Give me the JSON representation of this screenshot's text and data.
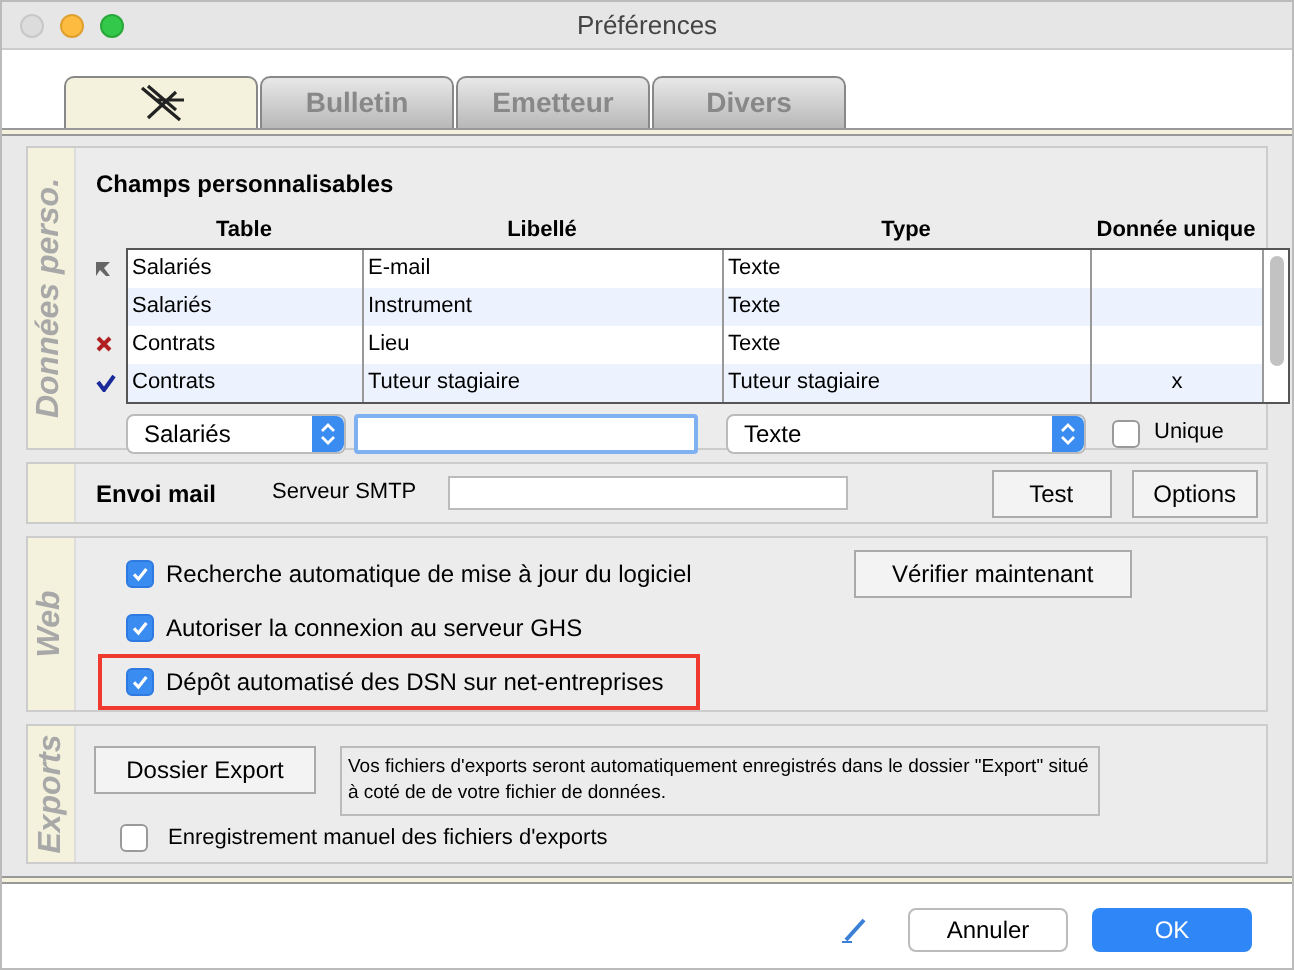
{
  "window": {
    "title": "Préférences"
  },
  "tabs": [
    {
      "kind": "icon",
      "selected": true
    },
    {
      "kind": "text",
      "label": "Bulletin",
      "selected": false
    },
    {
      "kind": "text",
      "label": "Emetteur",
      "selected": false
    },
    {
      "kind": "text",
      "label": "Divers",
      "selected": false
    }
  ],
  "custom_fields": {
    "section": "Données perso.",
    "title": "Champs personnalisables",
    "columns": [
      "Table",
      "Libellé",
      "Type",
      "Donnée unique"
    ],
    "rows": [
      {
        "kind": "pointer",
        "cells": [
          "Salariés",
          "E-mail",
          "Texte",
          ""
        ]
      },
      {
        "kind": "plain",
        "cells": [
          "Salariés",
          "Instrument",
          "Texte",
          ""
        ]
      },
      {
        "kind": "delete",
        "cells": [
          "Contrats",
          "Lieu",
          "Texte",
          ""
        ]
      },
      {
        "kind": "valid",
        "cells": [
          "Contrats",
          "Tuteur stagiaire",
          "Tuteur stagiaire",
          "x"
        ]
      }
    ],
    "table_select": "Salariés",
    "type_select": "Texte",
    "unique": {
      "label": "Unique",
      "checked": false
    }
  },
  "mail": {
    "title": "Envoi mail",
    "smtp_label": "Serveur SMTP",
    "buttons": [
      "Test",
      "Options"
    ]
  },
  "web": {
    "section": "Web",
    "options": [
      {
        "label": "Recherche automatique de mise à jour du logiciel",
        "checked": true,
        "highlighted": false
      },
      {
        "label": "Autoriser la connexion au serveur GHS",
        "checked": true,
        "highlighted": false
      },
      {
        "label": "Dépôt automatisé des DSN sur net-entreprises",
        "checked": true,
        "highlighted": true
      }
    ],
    "check_button": "Vérifier maintenant"
  },
  "exports": {
    "section": "Exports",
    "button": "Dossier Export",
    "note": "Vos fichiers d'exports seront automatiquement enregistrés dans le dossier \"Export\" situé à coté de de votre fichier de données.",
    "manual": {
      "label": "Enregistrement manuel des fichiers d'exports",
      "checked": false
    }
  },
  "footer": {
    "cancel": "Annuler",
    "ok": "OK"
  }
}
